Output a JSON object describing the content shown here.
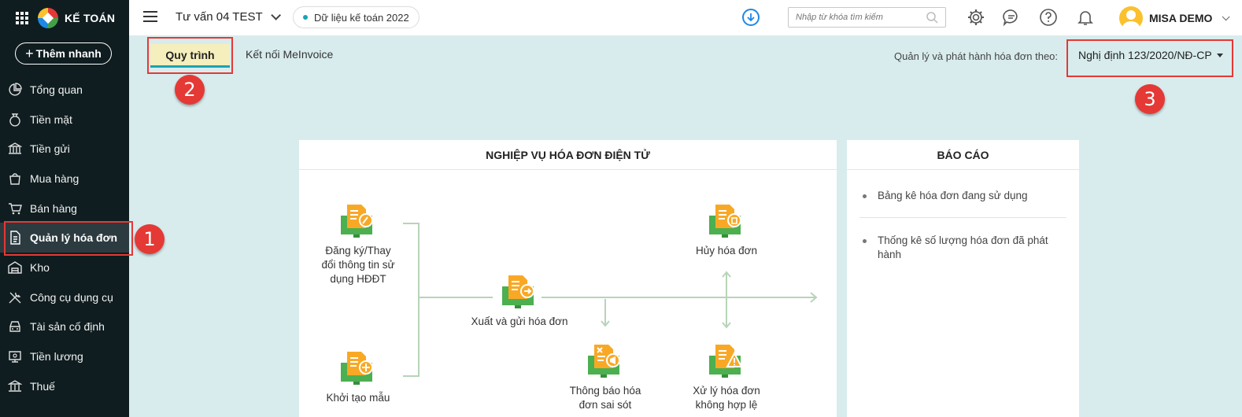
{
  "app": {
    "brand": "KẾ TOÁN",
    "quick_add": "Thêm nhanh"
  },
  "sidebar": {
    "items": [
      {
        "label": "Tổng quan",
        "icon": "chart-pie-icon"
      },
      {
        "label": "Tiền mặt",
        "icon": "money-bag-icon"
      },
      {
        "label": "Tiền gửi",
        "icon": "bank-icon"
      },
      {
        "label": "Mua hàng",
        "icon": "shopping-bag-icon"
      },
      {
        "label": "Bán hàng",
        "icon": "cart-icon"
      },
      {
        "label": "Quản lý hóa đơn",
        "icon": "invoice-icon",
        "active": true
      },
      {
        "label": "Kho",
        "icon": "warehouse-icon"
      },
      {
        "label": "Công cụ dụng cụ",
        "icon": "tools-icon"
      },
      {
        "label": "Tài sản cố định",
        "icon": "car-icon"
      },
      {
        "label": "Tiền lương",
        "icon": "payroll-icon"
      },
      {
        "label": "Thuế",
        "icon": "tax-icon"
      }
    ]
  },
  "header": {
    "company": "Tư vấn 04 TEST",
    "dataset": "Dữ liệu kế toán 2022",
    "search_placeholder": "Nhập từ khóa tìm kiếm",
    "user": "MISA DEMO"
  },
  "tabs": [
    {
      "label": "Quy trình",
      "active": true
    },
    {
      "label": "Kết nối MeInvoice"
    }
  ],
  "regulation": {
    "label": "Quản lý và phát hành hóa đơn theo:",
    "value": "Nghị định 123/2020/NĐ-CP"
  },
  "callouts": [
    "1",
    "2",
    "3"
  ],
  "main_panel": {
    "title": "NGHIỆP VỤ HÓA ĐƠN ĐIỆN TỬ",
    "nodes": {
      "register": {
        "line1": "Đăng ký/Thay",
        "line2": "đổi thông tin sử",
        "line3": "dụng HĐĐT"
      },
      "template": {
        "line1": "Khởi tạo mẫu"
      },
      "issue": {
        "line1": "Xuất và gửi hóa đơn"
      },
      "cancel": {
        "line1": "Hủy hóa đơn"
      },
      "notify": {
        "line1": "Thông báo hóa",
        "line2": "đơn sai sót"
      },
      "handle": {
        "line1": "Xử lý hóa đơn",
        "line2": "không hợp lệ"
      }
    }
  },
  "report_panel": {
    "title": "BÁO CÁO",
    "items": [
      "Bảng kê hóa đơn đang sử dụng",
      "Thống kê số lượng hóa đơn đã phát hành"
    ]
  },
  "colors": {
    "accent": "#1aa3b3",
    "highlight": "#e53935",
    "sidebar": "#0f1d20",
    "background": "#d8ecee"
  }
}
